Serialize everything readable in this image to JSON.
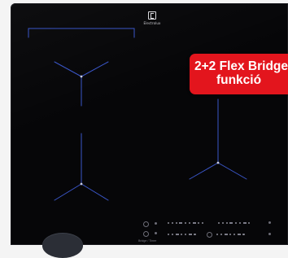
{
  "brand": {
    "logo_icon": "electrolux-logo-icon",
    "name": "Electrolux"
  },
  "badge": {
    "line1": "2+2 Flex Bridge",
    "line2": "funkció",
    "color": "#e3151d"
  },
  "hob": {
    "surface_color": "#060608",
    "line_color": "#3a56c8",
    "zone_count": 4
  },
  "controls": {
    "timer_label": "Bridge / Timer"
  }
}
